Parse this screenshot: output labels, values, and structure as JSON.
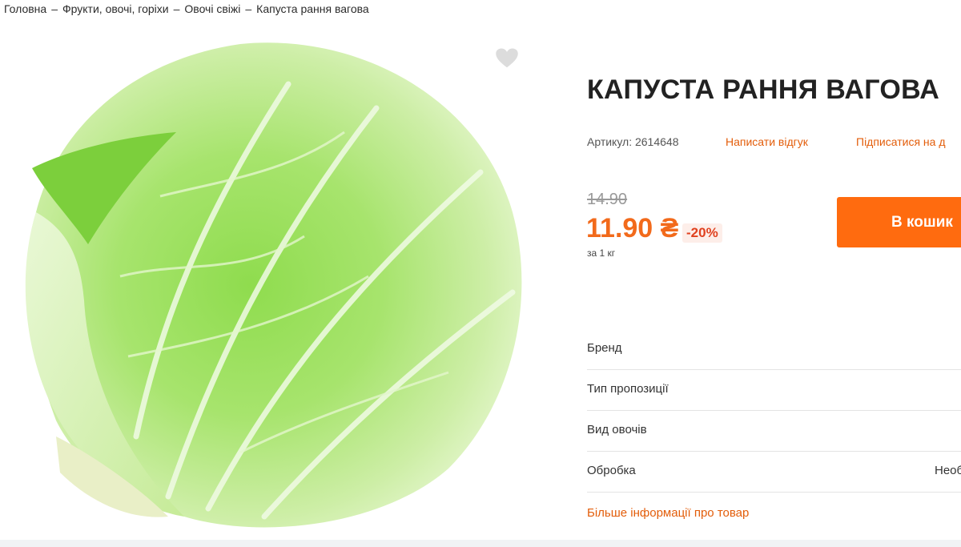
{
  "breadcrumb": {
    "items": [
      "Головна",
      "Фрукти, овочі, горіхи",
      "Овочі свіжі",
      "Капуста рання вагова"
    ],
    "separator": "–"
  },
  "product": {
    "title": "КАПУСТА РАННЯ ВАГОВА",
    "sku": "Артикул: 2614648",
    "write_review": "Написати відгук",
    "subscribe": "Підписатися на д",
    "old_price": "14.90",
    "new_price": "11.90 ₴",
    "discount": "-20%",
    "unit": "за 1 кг",
    "cart_button": "В кошик"
  },
  "attributes": [
    {
      "label": "Бренд",
      "value": ""
    },
    {
      "label": "Тип пропозиції",
      "value": ""
    },
    {
      "label": "Вид овочів",
      "value": ""
    },
    {
      "label": "Обробка",
      "value": "Необ"
    }
  ],
  "more_info": "Більше інформації про товар",
  "icons": {
    "wishlist": "heart-icon"
  },
  "colors": {
    "accent": "#ff6b0f",
    "price": "#f26a1b",
    "link": "#e35d0a",
    "discount": "#e0411f"
  }
}
